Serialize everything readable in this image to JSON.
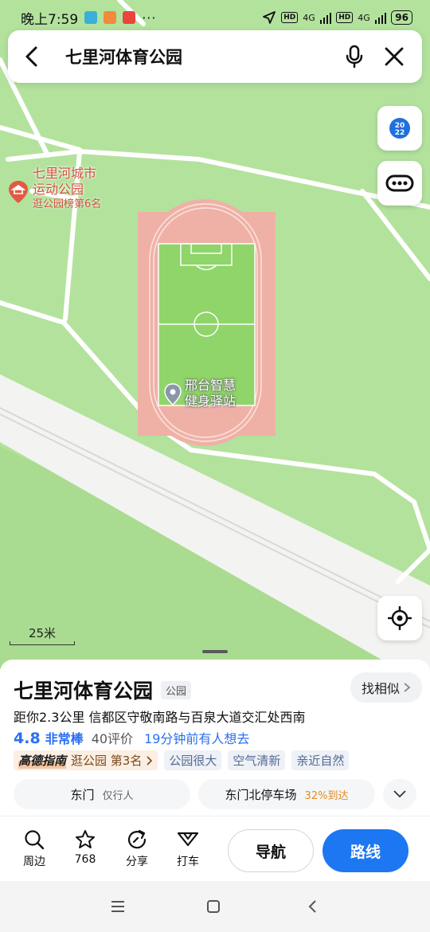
{
  "status_bar": {
    "time": "晚上7:59",
    "more": "···",
    "hd1": "HD",
    "net1": "4G",
    "hd2": "HD",
    "net2": "4G",
    "battery": "96"
  },
  "search": {
    "query": "七里河体育公园"
  },
  "map": {
    "poi_name_line1": "七里河城市",
    "poi_name_line2": "运动公园",
    "poi_rank": "逛公园榜第6名",
    "station_line1": "邢台智慧",
    "station_line2": "健身驿站",
    "year_badge_top": "20",
    "year_badge_bottom": "22",
    "scale_label": "25米"
  },
  "sheet": {
    "title": "七里河体育公园",
    "category": "公园",
    "similar_label": "找相似",
    "address": "距你2.3公里  信都区守敬南路与百泉大道交汇处西南",
    "rating_score": "4.8",
    "rating_word": "非常棒",
    "rating_count": "40评价",
    "recent_interest": "19分钟前有人想去",
    "guide_brand": "高德指南",
    "guide_text": "逛公园 第3名",
    "features": [
      "公园很大",
      "空气清新",
      "亲近自然"
    ],
    "entrance_1_name": "东门",
    "entrance_1_note": "仅行人",
    "entrance_2_name": "东门北停车场",
    "entrance_2_pct": "32%到达"
  },
  "actions": {
    "nearby": "周边",
    "favorite_count": "768",
    "share": "分享",
    "taxi": "打车",
    "navigate": "导航",
    "route": "路线"
  },
  "colors": {
    "map_green": "#b3e29d",
    "track": "#efb1a6",
    "field": "#8fd56a",
    "accent_blue": "#1d77f2",
    "poi_red": "#d2543e"
  }
}
